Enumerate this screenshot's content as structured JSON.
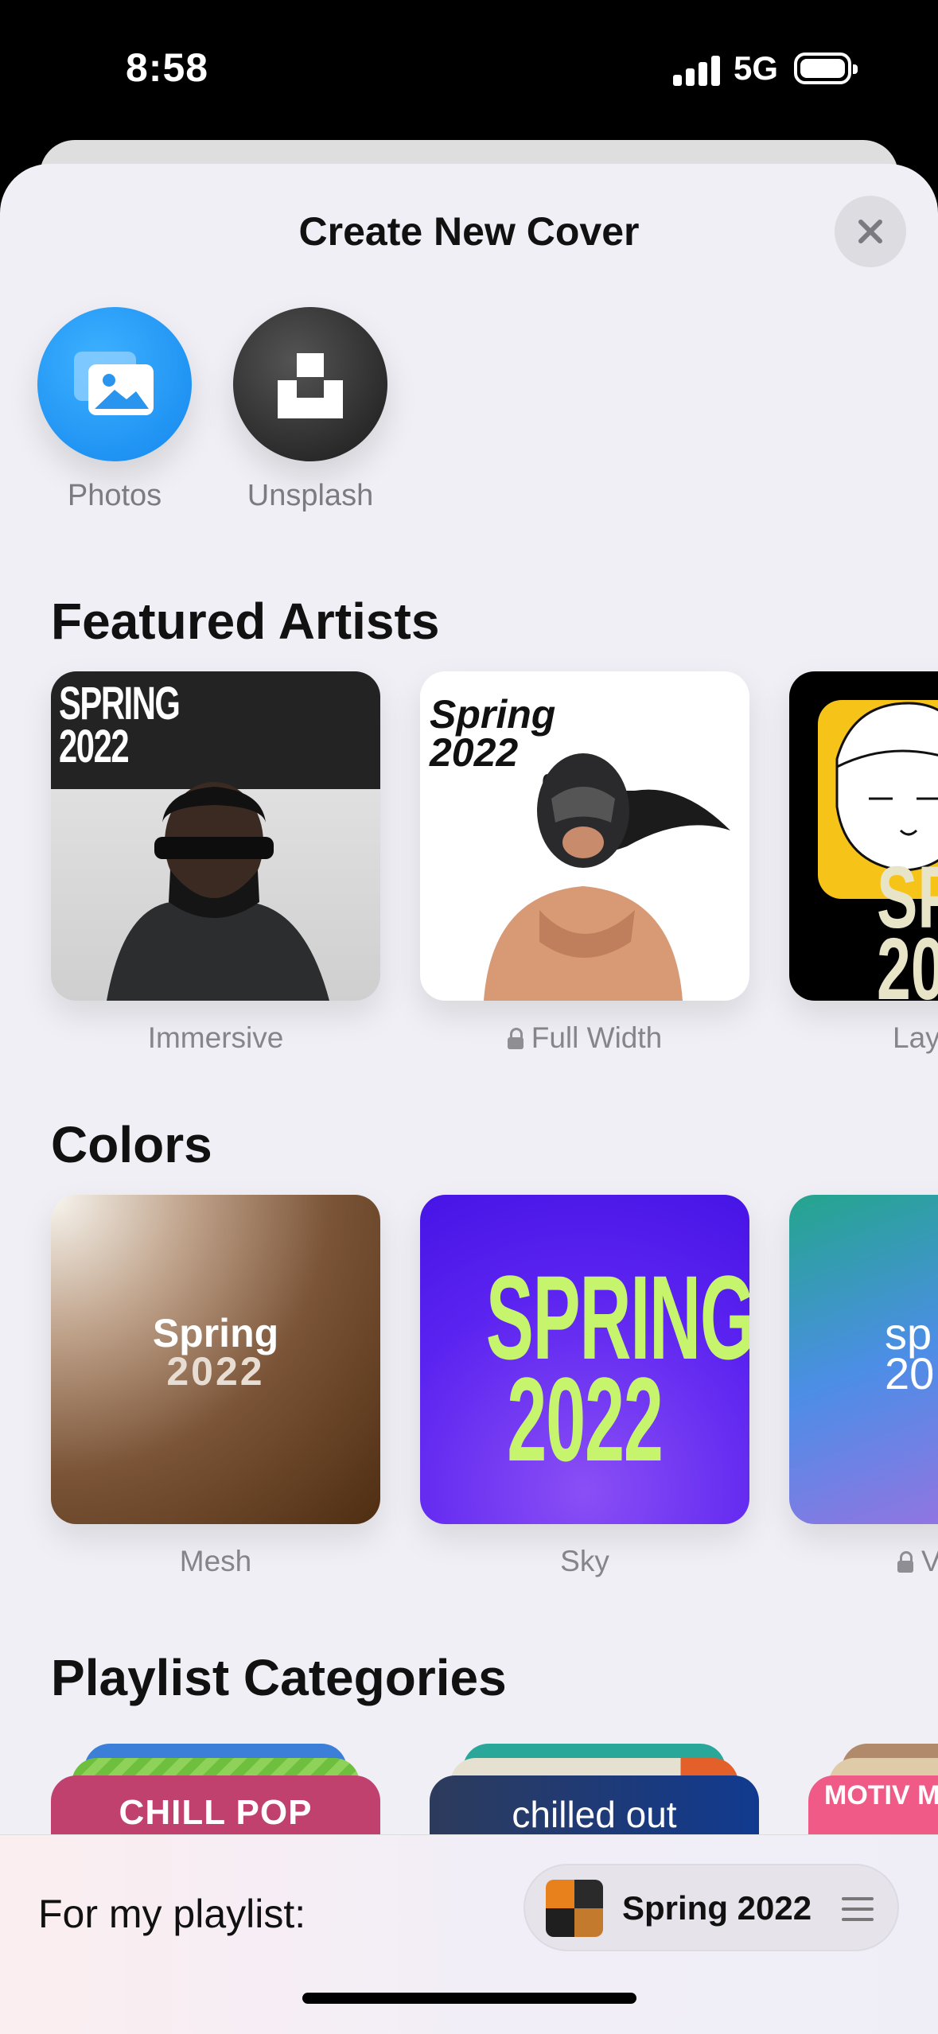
{
  "status_bar": {
    "time": "8:58",
    "network": "5G"
  },
  "sheet": {
    "title": "Create New Cover"
  },
  "sources": [
    {
      "label": "Photos",
      "icon": "photos-icon"
    },
    {
      "label": "Unsplash",
      "icon": "unsplash-icon"
    }
  ],
  "featured": {
    "title": "Featured Artists",
    "items": [
      {
        "label": "Immersive",
        "art_text_1": "SPRING",
        "art_text_2": "2022",
        "locked": false
      },
      {
        "label": "Full Width",
        "art_text_1": "Spring",
        "art_text_2": "2022",
        "locked": true
      },
      {
        "label": "Lay",
        "art_text_1": "SPI",
        "art_text_2": "20",
        "locked": false
      }
    ]
  },
  "colors": {
    "title": "Colors",
    "items": [
      {
        "label": "Mesh",
        "art_text_1": "Spring",
        "art_text_2": "2022",
        "locked": false
      },
      {
        "label": "Sky",
        "art_text_1": "SPRING",
        "art_text_2": "2022",
        "locked": false
      },
      {
        "label": "V",
        "art_text_1": "sp",
        "art_text_2": "20",
        "locked": true
      }
    ]
  },
  "categories": {
    "title": "Playlist Categories",
    "items": [
      {
        "label": "CHILL POP"
      },
      {
        "label": "chilled out"
      },
      {
        "label": "MOTIV MIX"
      }
    ]
  },
  "bottom": {
    "label": "For my playlist:",
    "playlist_name": "Spring 2022"
  },
  "colors_palette": {
    "accent_blue": "#1487ee",
    "sheet_background": "#f0eff5",
    "sky_purple": "#5b23f0",
    "sky_text": "#c6f56d"
  }
}
